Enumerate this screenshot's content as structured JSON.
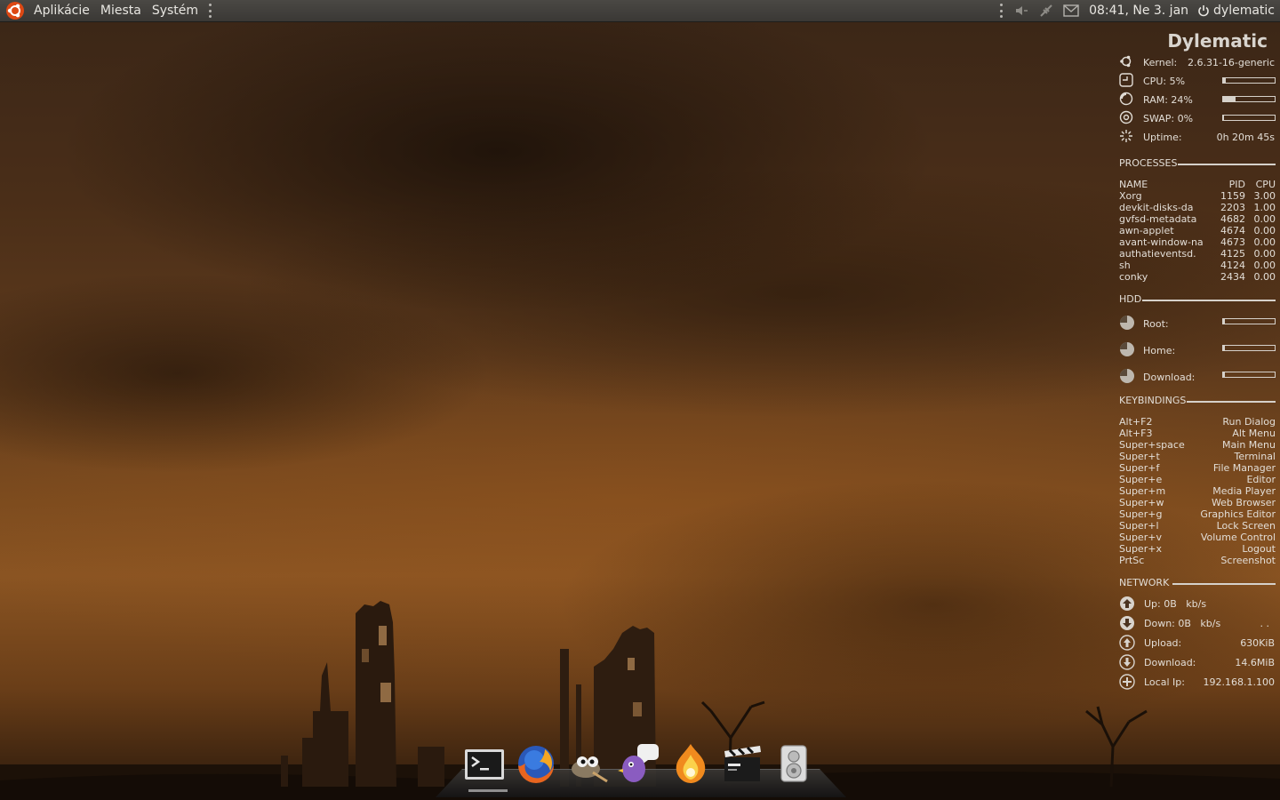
{
  "top_panel": {
    "menus": [
      "Aplikácie",
      "Miesta",
      "Systém"
    ],
    "clock": "08:41, Ne  3. jan",
    "user": "dylematic",
    "tray_icons": [
      "volume-icon",
      "network-icon",
      "mail-icon"
    ]
  },
  "conky": {
    "title": "Dylematic",
    "system": {
      "kernel_label": "Kernel:",
      "kernel_value": "2.6.31-16-generic",
      "cpu_label": "CPU: 5%",
      "cpu_level": 0.05,
      "ram_label": "RAM: 24%",
      "ram_level": 0.24,
      "swap_label": "SWAP: 0%",
      "swap_level": 0.0,
      "uptime_label": "Uptime:",
      "uptime_value": "0h 20m 45s"
    },
    "processes": {
      "heading": "PROCESSES",
      "columns": [
        "NAME",
        "PID",
        "CPU"
      ],
      "rows": [
        [
          "Xorg",
          "1159",
          "3.00"
        ],
        [
          "devkit-disks-da",
          "2203",
          "1.00"
        ],
        [
          "gvfsd-metadata",
          "4682",
          "0.00"
        ],
        [
          "awn-applet",
          "4674",
          "0.00"
        ],
        [
          "avant-window-na",
          "4673",
          "0.00"
        ],
        [
          "authatieventsd.",
          "4125",
          "0.00"
        ],
        [
          "sh",
          "4124",
          "0.00"
        ],
        [
          "conky",
          "2434",
          "0.00"
        ]
      ]
    },
    "hdd": {
      "heading": "HDD",
      "items": [
        {
          "label": "Root:",
          "level": 0.04
        },
        {
          "label": "Home:",
          "level": 0.04
        },
        {
          "label": "Download:",
          "level": 0.04
        }
      ]
    },
    "keybindings": {
      "heading": "KEYBINDINGS",
      "rows": [
        [
          "Alt+F2",
          "Run Dialog"
        ],
        [
          "Alt+F3",
          "Alt Menu"
        ],
        [
          "Super+space",
          "Main Menu"
        ],
        [
          "Super+t",
          "Terminal"
        ],
        [
          "Super+f",
          "File Manager"
        ],
        [
          "Super+e",
          "Editor"
        ],
        [
          "Super+m",
          "Media Player"
        ],
        [
          "Super+w",
          "Web Browser"
        ],
        [
          "Super+g",
          "Graphics Editor"
        ],
        [
          "Super+l",
          "Lock Screen"
        ],
        [
          "Super+v",
          "Volume Control"
        ],
        [
          "Super+x",
          "Logout"
        ],
        [
          "PrtSc",
          "Screenshot"
        ]
      ]
    },
    "network": {
      "heading": "NETWORK",
      "up": "Up: 0B   kb/s",
      "down": "Down: 0B   kb/s",
      "down_extra": ". .",
      "upload_label": "Upload:",
      "upload_value": "630KiB",
      "download_label": "Download:",
      "download_value": "14.6MiB",
      "local_ip_label": "Local Ip:",
      "local_ip_value": "192.168.1.100"
    }
  },
  "dock": {
    "items": [
      "terminal-icon",
      "firefox-icon",
      "gimp-icon",
      "pidgin-icon",
      "burner-icon",
      "video-editor-icon",
      "speaker-icon"
    ]
  },
  "colors": {
    "panel": "#3f3d3a",
    "sky_dark": "#3a2617",
    "sky_glow": "#8a5422",
    "conky_text": "#e2ddd6"
  }
}
